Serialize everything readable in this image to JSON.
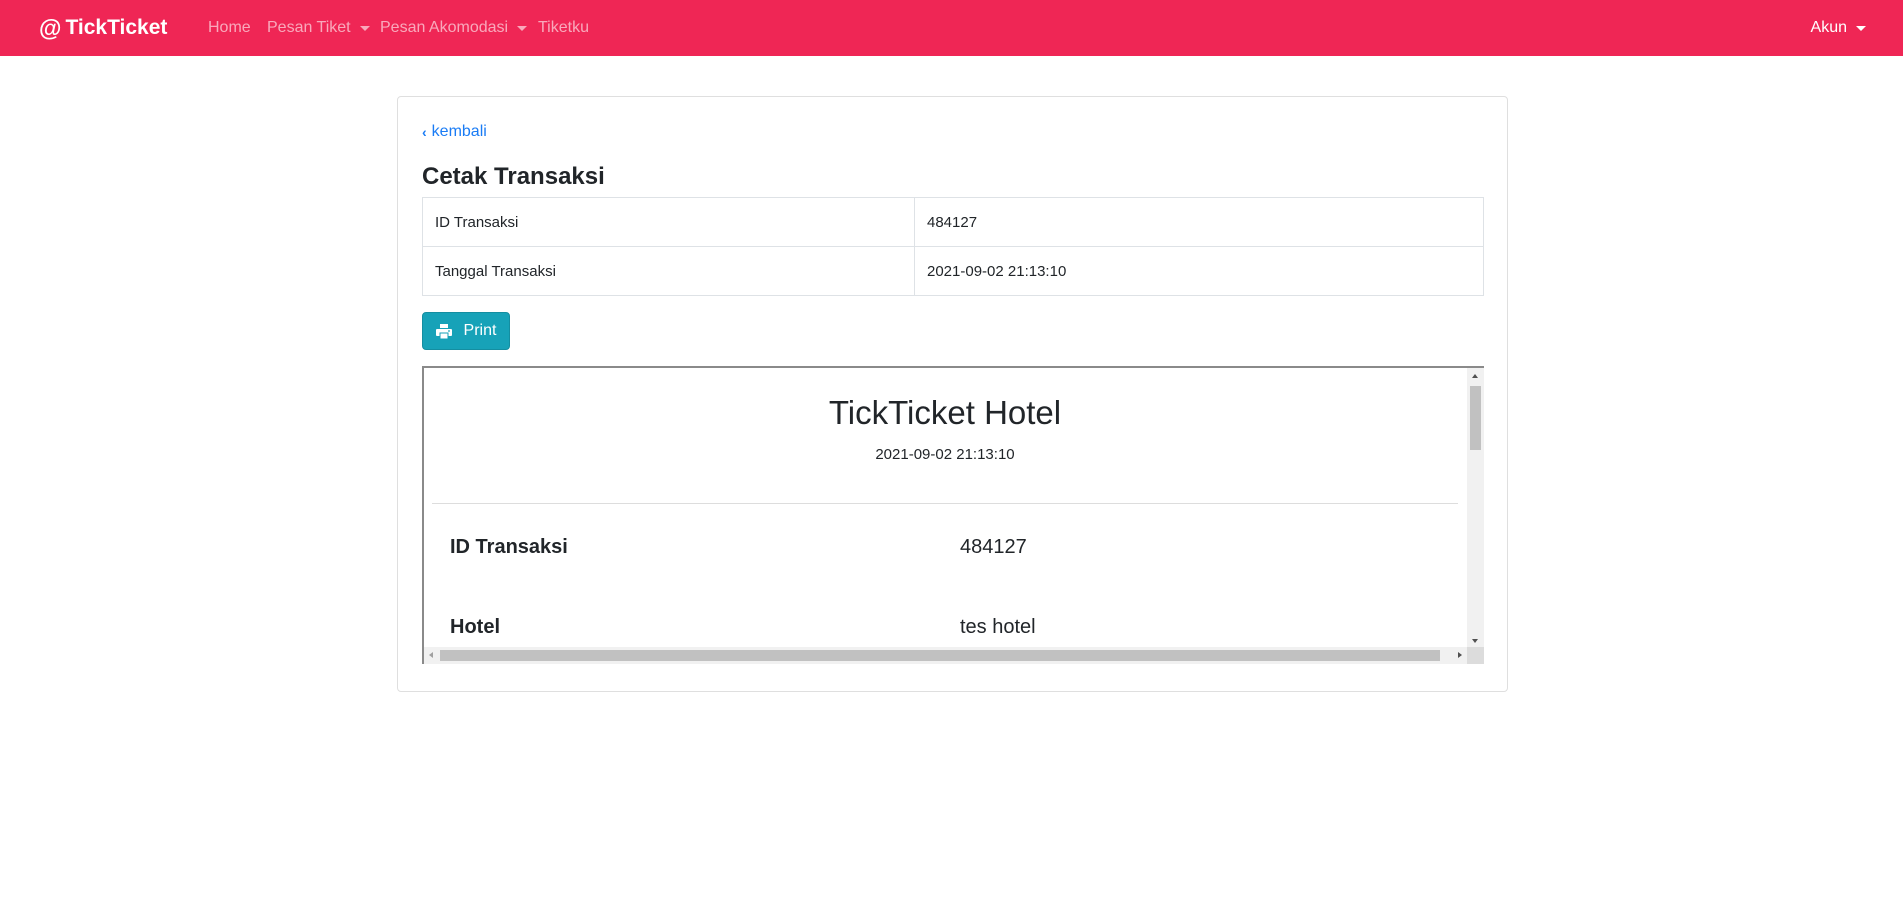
{
  "navbar": {
    "brand_icon": "@",
    "brand": "TickTicket",
    "items": [
      {
        "label": "Home"
      },
      {
        "label": "Pesan Tiket"
      },
      {
        "label": "Pesan Akomodasi"
      },
      {
        "label": "Tiketku"
      }
    ],
    "account": "Akun",
    "color": "#ef2655"
  },
  "card": {
    "back_link": "kembali",
    "title": "Cetak Transaksi",
    "rows": [
      {
        "label": "ID Transaksi",
        "value": "484127"
      },
      {
        "label": "Tanggal Transaksi",
        "value": "2021-09-02 21:13:10"
      }
    ],
    "print_button": "Print",
    "print_color": "#17a2b8"
  },
  "preview": {
    "title": "TickTicket Hotel",
    "date": "2021-09-02 21:13:10",
    "fields": [
      {
        "label": "ID Transaksi",
        "value": "484127"
      },
      {
        "label": "Hotel",
        "value": "tes hotel"
      }
    ]
  }
}
